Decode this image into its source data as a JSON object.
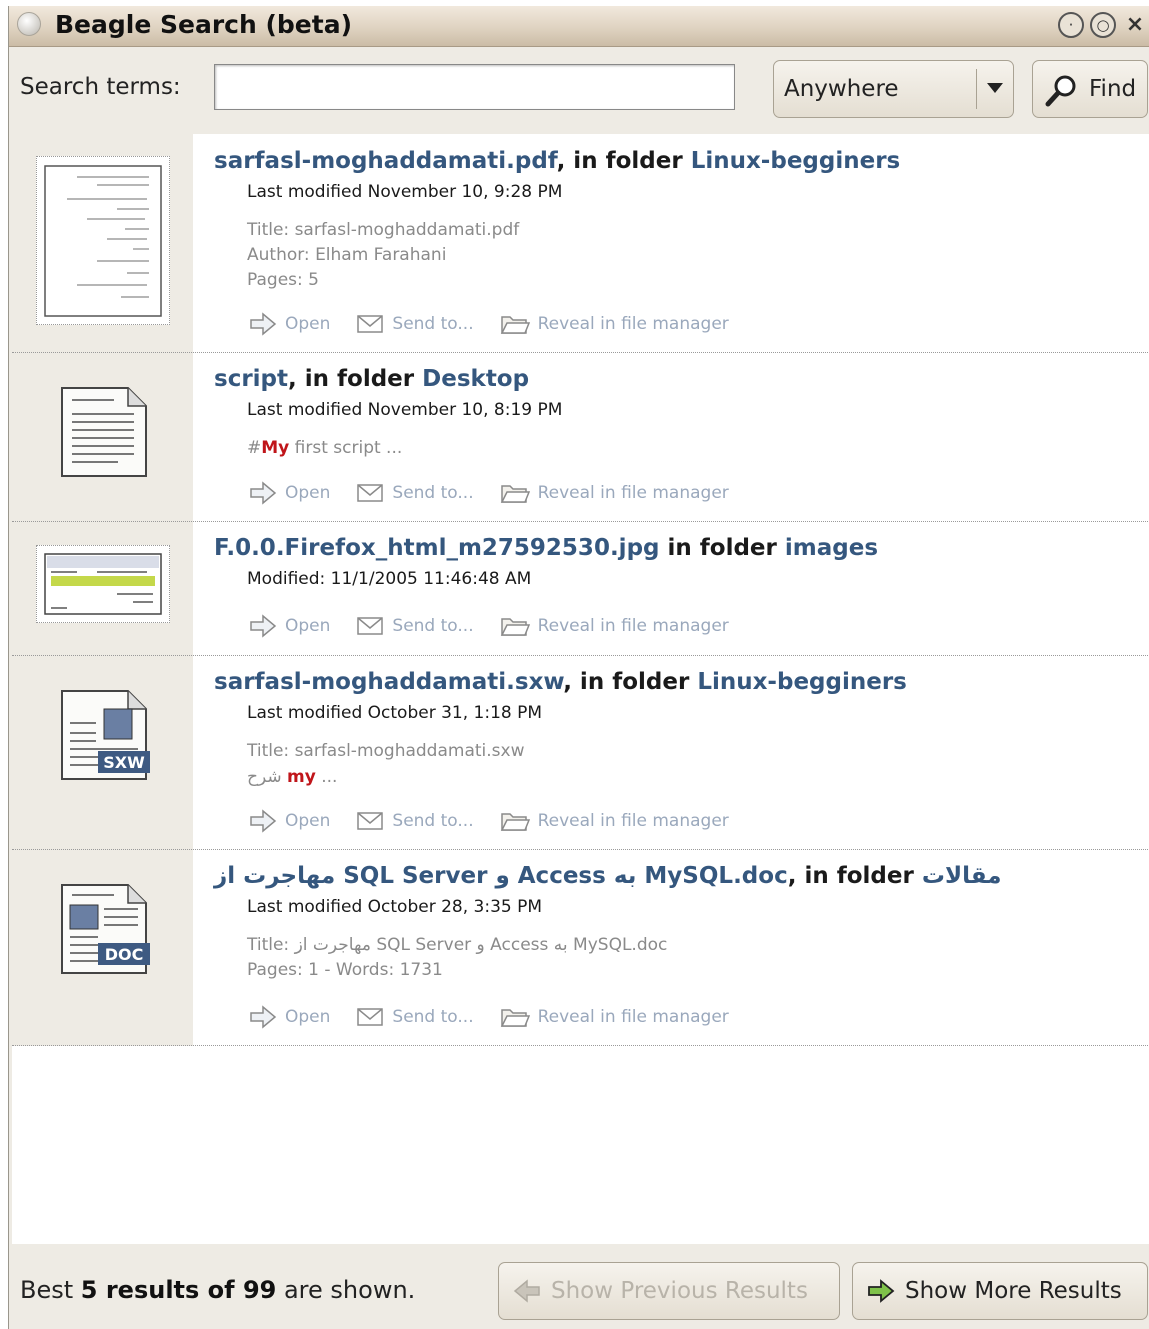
{
  "window": {
    "title": "Beagle Search (beta)"
  },
  "search": {
    "label": "Search terms:",
    "value": "",
    "scope": "Anywhere",
    "find_label": "Find"
  },
  "actions": {
    "open": "Open",
    "send": "Send to...",
    "reveal": "Reveal in file manager"
  },
  "results": [
    {
      "name": "sarfasl-moghaddamati.pdf",
      "in_folder": ", in folder ",
      "folder": "Linux-begginers",
      "modified": "Last modified November 10, 9:28 PM",
      "details": [
        "Title: sarfasl-moghaddamati.pdf",
        "Author: Elham Farahani",
        "Pages: 5"
      ],
      "icon": "pdf-thumbnail"
    },
    {
      "name": "script",
      "in_folder": ", in folder ",
      "folder": "Desktop",
      "modified": "Last modified November 10, 8:19 PM",
      "snippet": {
        "pre": "#",
        "hit": "My",
        "post": " first script ..."
      },
      "icon": "text-document-icon"
    },
    {
      "name": "F.0.0.Firefox_html_m27592530.jpg",
      "in_folder": " in folder ",
      "folder": "images",
      "modified": "Modified: 11/1/2005 11:46:48 AM",
      "icon": "image-thumbnail"
    },
    {
      "name": "sarfasl-moghaddamati.sxw",
      "in_folder": ", in folder ",
      "folder": "Linux-begginers",
      "modified": "Last modified October 31, 1:18 PM",
      "details": [
        "Title: sarfasl-moghaddamati.sxw"
      ],
      "snippet": {
        "pre": "شرح ",
        "hit": "my",
        "post": " ..."
      },
      "icon": "sxw-document-icon",
      "badge": "SXW"
    },
    {
      "name": "مهاجرت از SQL Server و Access به MySQL.doc",
      "in_folder": ", in folder ",
      "folder": "مقالات",
      "modified": "Last modified October 28, 3:35 PM",
      "details": [
        "Title: مهاجرت از SQL Server و Access به MySQL.doc",
        "Pages: 1 - Words: 1731"
      ],
      "icon": "doc-document-icon",
      "badge": "DOC"
    }
  ],
  "footer": {
    "status_pre": "Best ",
    "status_bold": "5 results of 99",
    "status_post": " are shown.",
    "prev_label": "Show Previous Results",
    "more_label": "Show More Results"
  },
  "colors": {
    "link": "#35577e",
    "hit": "#c0151a",
    "action": "#9aa8bc",
    "chrome": "#eeebe4"
  }
}
